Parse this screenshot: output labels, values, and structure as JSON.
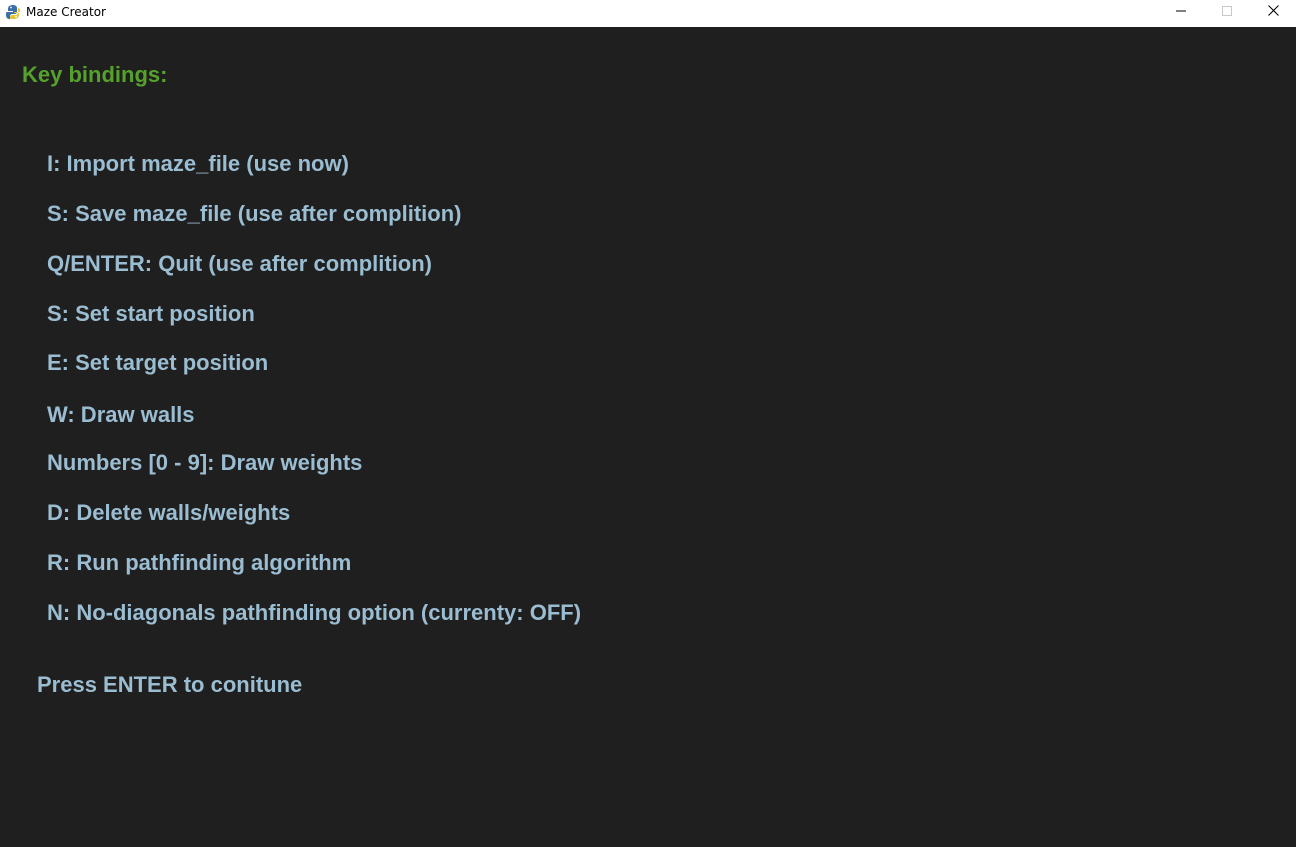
{
  "window": {
    "title": "Maze Creator",
    "app_icon": "pygame-snake-icon",
    "controls": {
      "minimize_icon": "minimize-icon",
      "maximize_icon": "maximize-icon",
      "close_icon": "close-icon"
    }
  },
  "colors": {
    "background": "#1f1f1f",
    "heading": "#56a02c",
    "text": "#9bbdd2"
  },
  "content": {
    "heading": "Key bindings:",
    "bindings": [
      "I: Import maze_file (use now)",
      "S: Save maze_file (use after complition)",
      "Q/ENTER: Quit (use after complition)",
      "S: Set start position",
      "E: Set target position",
      "W: Draw walls",
      "Numbers [0 - 9]: Draw weights",
      "D: Delete walls/weights",
      "R: Run pathfinding algorithm",
      "N: No-diagonals pathfinding option (currenty: OFF)"
    ],
    "footer": "Press ENTER to conitune"
  }
}
